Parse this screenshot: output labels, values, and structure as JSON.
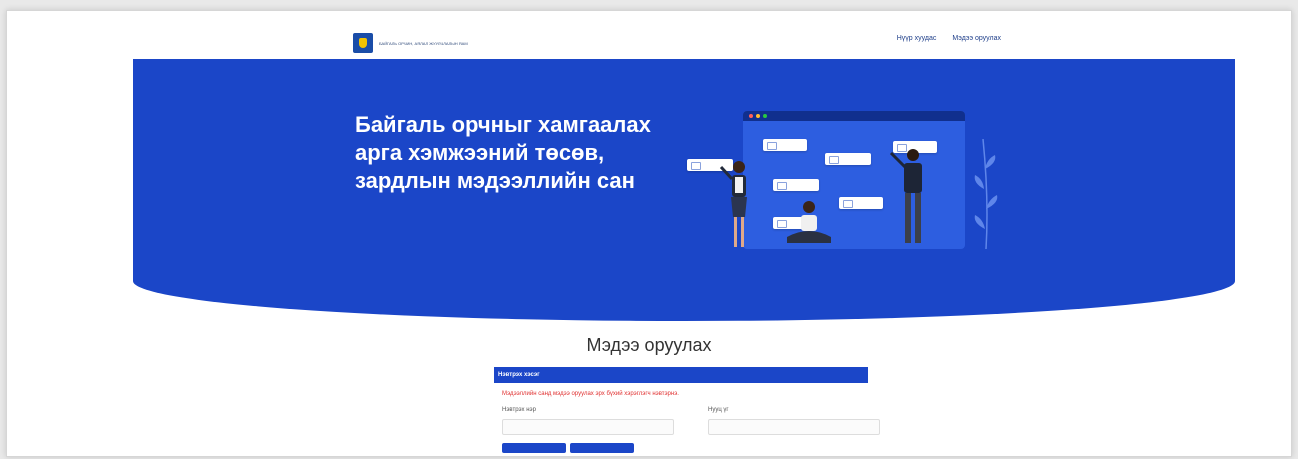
{
  "header": {
    "logo_text": "БАЙГАЛЬ ОРЧИН, АЯЛАЛ ЖУУЛЧЛАЛЫН ЯАМ",
    "nav": [
      {
        "label": "Нүүр хуудас"
      },
      {
        "label": "Мэдээ оруулах"
      }
    ]
  },
  "hero": {
    "title": "Байгаль орчныг хамгаалах арга хэмжээний төсөв, зардлын мэдээллийн сан"
  },
  "main": {
    "section_title": "Мэдээ оруулах",
    "panel_title": "Нэвтрэх хэсэг",
    "notice": "Мэдээллийн санд мэдээ оруулах эрх бүхий хэрэглэгч нэвтэрнэ.",
    "fields": [
      {
        "label": "Нэвтрэх нэр",
        "value": ""
      },
      {
        "label": "Нууц үг",
        "value": ""
      }
    ]
  },
  "colors": {
    "primary": "#1b46c8",
    "warning_text": "#e03030"
  }
}
